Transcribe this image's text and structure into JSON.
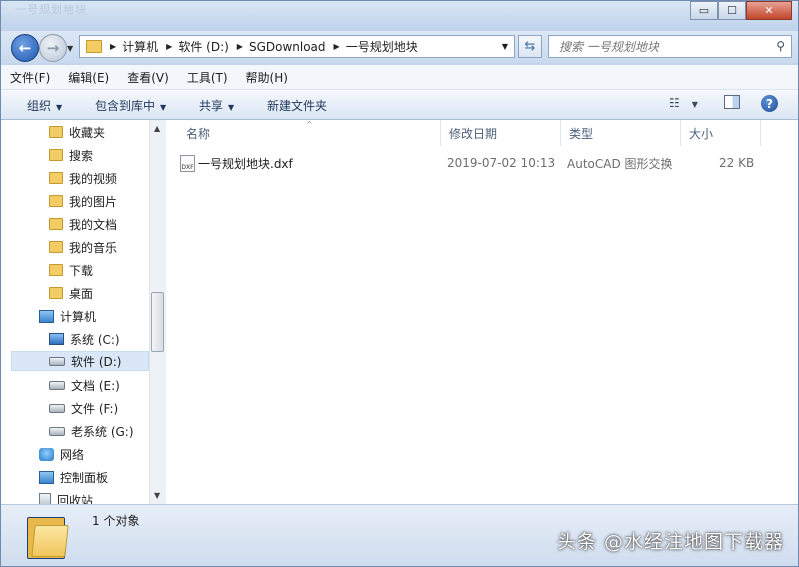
{
  "window": {
    "ghost_title": "一号规划地块",
    "controls": {
      "minimize": "▭",
      "maximize": "☐",
      "close": "✕"
    }
  },
  "nav": {
    "back_icon": "back-arrow-icon",
    "forward_icon": "forward-arrow-icon",
    "breadcrumbs": [
      "计算机",
      "软件 (D:)",
      "SGDownload",
      "一号规划地块"
    ],
    "search_placeholder": "搜索 一号规划地块"
  },
  "menu": [
    "文件(F)",
    "编辑(E)",
    "查看(V)",
    "工具(T)",
    "帮助(H)"
  ],
  "toolbar": {
    "organize": "组织",
    "include_library": "包含到库中",
    "share": "共享",
    "new_folder": "新建文件夹"
  },
  "sidebar": {
    "items": [
      {
        "label": "收藏夹",
        "icon": "folder-star-icon"
      },
      {
        "label": "搜索",
        "icon": "search-folder-icon"
      },
      {
        "label": "我的视频",
        "icon": "folder-icon"
      },
      {
        "label": "我的图片",
        "icon": "folder-icon"
      },
      {
        "label": "我的文档",
        "icon": "folder-icon"
      },
      {
        "label": "我的音乐",
        "icon": "folder-icon"
      },
      {
        "label": "下载",
        "icon": "download-folder-icon"
      },
      {
        "label": "桌面",
        "icon": "desktop-folder-icon"
      },
      {
        "label": "计算机",
        "icon": "computer-icon"
      },
      {
        "label": "系统 (C:)",
        "icon": "system-drive-icon"
      },
      {
        "label": "软件 (D:)",
        "icon": "drive-icon",
        "selected": true
      },
      {
        "label": "文档 (E:)",
        "icon": "drive-icon"
      },
      {
        "label": "文件 (F:)",
        "icon": "drive-icon"
      },
      {
        "label": "老系统 (G:)",
        "icon": "drive-icon"
      },
      {
        "label": "网络",
        "icon": "network-icon"
      },
      {
        "label": "控制面板",
        "icon": "control-panel-icon"
      },
      {
        "label": "回收站",
        "icon": "recycle-bin-icon"
      }
    ]
  },
  "columns": [
    "名称",
    "修改日期",
    "类型",
    "大小"
  ],
  "files": [
    {
      "name": "一号规划地块.dxf",
      "modified": "2019-07-02 10:13",
      "type": "AutoCAD 图形交换",
      "size": "22 KB",
      "icon_text": "DXF"
    }
  ],
  "status": {
    "count": "1 个对象",
    "watermark": "头条 @水经注地图下载器"
  }
}
